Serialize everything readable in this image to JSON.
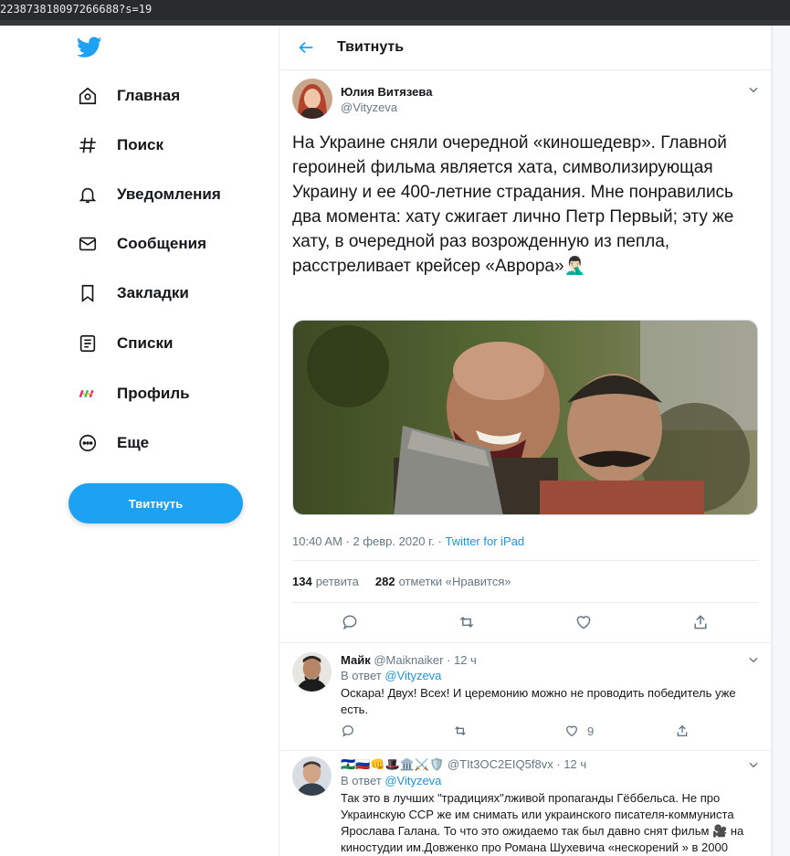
{
  "browser": {
    "url_fragment": "223873818097266688?s=19"
  },
  "sidebar": {
    "logo_icon": "twitter-bird-icon",
    "items": [
      {
        "label": "Главная",
        "icon": "home-icon"
      },
      {
        "label": "Поиск",
        "icon": "hashtag-icon"
      },
      {
        "label": "Уведомления",
        "icon": "bell-icon"
      },
      {
        "label": "Сообщения",
        "icon": "envelope-icon"
      },
      {
        "label": "Закладки",
        "icon": "bookmark-icon"
      },
      {
        "label": "Списки",
        "icon": "list-icon"
      },
      {
        "label": "Профиль",
        "icon": "profile-avatar-icon"
      },
      {
        "label": "Еще",
        "icon": "more-circle-icon"
      }
    ],
    "tweet_button": "Твитнуть"
  },
  "header": {
    "title": "Твитнуть"
  },
  "tweet": {
    "author_name": "Юлия Витязева",
    "author_handle": "@Vityzeva",
    "text": "На Украине сняли очередной «киношедевр». Главной героиней фильма является хата, символизирующая Украину и ее 400-летние страдания. Мне понравились два момента: хату сжигает лично Петр Первый; эту же хату, в очередной раз возрожденную из пепла, расстреливает крейсер «Аврора»🤦🏻‍♂️",
    "timestamp": "10:40 AM · 2 февр. 2020 г. · ",
    "source": "Twitter for iPad",
    "retweets_count": "134",
    "retweets_label": "ретвита",
    "likes_count": "282",
    "likes_label": "отметки «Нравится»"
  },
  "replies": [
    {
      "name": "Майк",
      "handle": "@Maiknaiker",
      "time": "· 12 ч",
      "reply_prefix": "В ответ ",
      "reply_to": "@Vityzeva",
      "text": "Оскара! Двух! Всех! И церемонию можно не проводить  победитель уже есть.",
      "likes": "9"
    },
    {
      "name": "🇱🇸🇷🇺👊🎩🏛️⚔️🛡️",
      "handle": "@TIt3OC2EIQ5f8vx",
      "time": "· 12 ч",
      "reply_prefix": "В ответ ",
      "reply_to": "@Vityzeva",
      "text": "Так это в лучших \"традициях\"лживой пропаганды Гёббельса. Не про Украинскую ССР же им снимать или украинского писателя-коммуниста Ярослава Галана. То что это ожидаемо так был давно снят фильм 🎥 на киностудии им.Довженко про Романа Шухевича «нескорений » в 2000"
    }
  ],
  "colors": {
    "accent": "#1da1f2",
    "link": "#1b95e0",
    "muted": "#657786",
    "border": "#e6ecf0"
  }
}
